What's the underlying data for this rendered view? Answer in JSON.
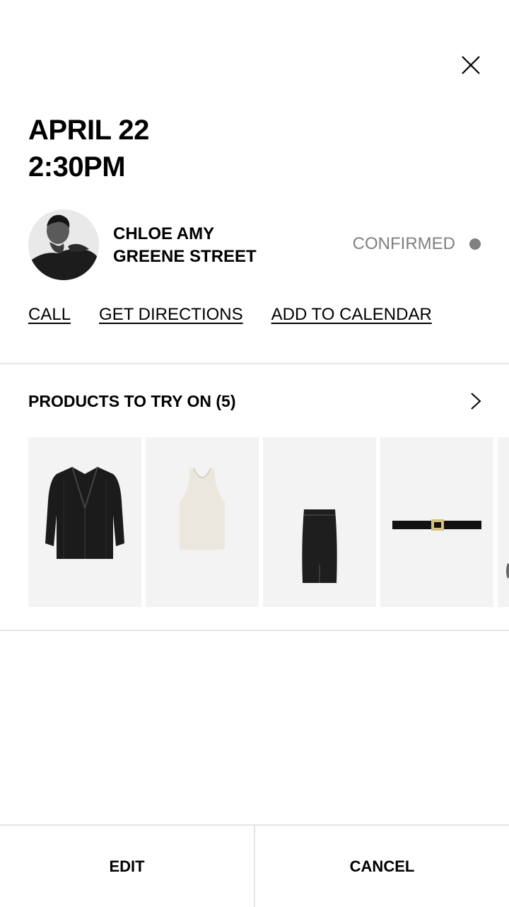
{
  "appointment": {
    "date": "APRIL 22",
    "time": "2:30PM",
    "status": "CONFIRMED",
    "status_color": "#808080"
  },
  "stylist": {
    "name": "CHLOE AMY",
    "location": "GREENE STREET"
  },
  "actions": {
    "call": "CALL",
    "directions": "GET DIRECTIONS",
    "calendar": "ADD TO CALENDAR"
  },
  "products": {
    "title": "PRODUCTS TO TRY ON (5)",
    "items": [
      {
        "icon": "blazer-icon"
      },
      {
        "icon": "tank-top-icon"
      },
      {
        "icon": "pencil-skirt-icon"
      },
      {
        "icon": "belt-icon"
      },
      {
        "icon": "partial-product-icon"
      }
    ]
  },
  "footer": {
    "edit": "EDIT",
    "cancel": "CANCEL"
  },
  "icons": {
    "close": "close-icon",
    "chevron": "chevron-right-icon"
  }
}
